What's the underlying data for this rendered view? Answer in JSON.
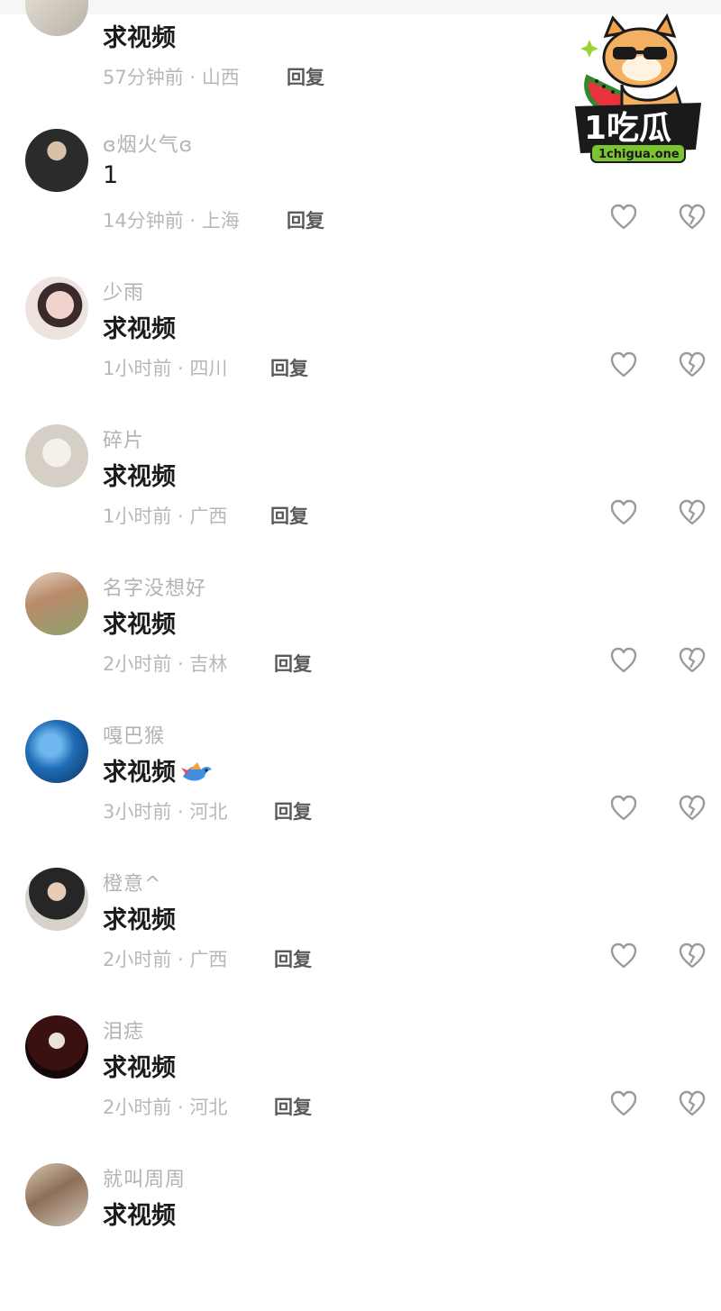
{
  "comments": [
    {
      "name": "",
      "text": "求视频",
      "time": "57分钟前",
      "location": "山西",
      "reply": "回复",
      "avatar_color": "#d9d4cc"
    },
    {
      "name": "ɞ烟火气ɞ",
      "text": "1",
      "time": "14分钟前",
      "location": "上海",
      "reply": "回复",
      "avatar_color": "#2a2a2a"
    },
    {
      "name": "少雨",
      "text": "求视频",
      "time": "1小时前",
      "location": "四川",
      "reply": "回复",
      "avatar_color": "#e9c9c3"
    },
    {
      "name": "碎片",
      "text": "求视频",
      "time": "1小时前",
      "location": "广西",
      "reply": "回复",
      "avatar_color": "#e7e3de"
    },
    {
      "name": "名字没想好",
      "text": "求视频",
      "time": "2小时前",
      "location": "吉林",
      "reply": "回复",
      "avatar_color": "#c9b39a"
    },
    {
      "name": "嘎巴猴",
      "text": "求视频",
      "time": "3小时前",
      "location": "河北",
      "reply": "回复",
      "avatar_color": "#2b6fb3"
    },
    {
      "name": "橙意^",
      "text": "求视频",
      "time": "2小时前",
      "location": "广西",
      "reply": "回复",
      "avatar_color": "#3a3a3a"
    },
    {
      "name": "泪痣",
      "text": "求视频",
      "time": "2小时前",
      "location": "河北",
      "reply": "回复",
      "avatar_color": "#5a1d1d"
    },
    {
      "name": "就叫周周",
      "text": "求视频",
      "time": "",
      "location": "",
      "reply": "",
      "avatar_color": "#b8a58f"
    }
  ],
  "separator": " · ",
  "icons": {
    "like": "heart-outline-icon",
    "dislike": "broken-heart-icon",
    "emoji": "flying-bird-emoji-icon"
  },
  "watermark": {
    "text_main": "1吃瓜",
    "text_url": "1chigua.one"
  }
}
